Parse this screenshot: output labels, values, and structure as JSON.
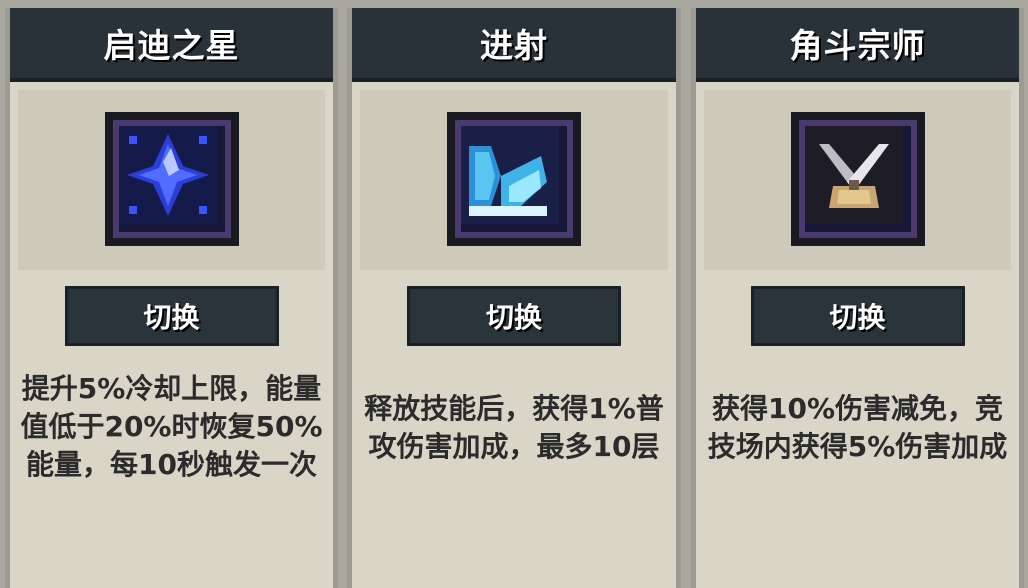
{
  "cards": [
    {
      "title": "启迪之星",
      "icon": "blue-star-crystal-icon",
      "button_label": "切换",
      "description": "提升5%冷却上限，能量值低于20%时恢复50%能量，每10秒触发一次"
    },
    {
      "title": "进射",
      "icon": "cyan-burst-icon",
      "button_label": "切换",
      "description": "释放技能后，获得1%普攻伤害加成，最多10层"
    },
    {
      "title": "角斗宗师",
      "icon": "crossed-swords-icon",
      "button_label": "切换",
      "description": "获得10%伤害减免，竞技场内获得5%伤害加成"
    }
  ],
  "colors": {
    "title_bar": "#293238",
    "card_bg": "#d9d6c8",
    "button_bg": "#2a343b",
    "text": "#2b2b2b"
  }
}
